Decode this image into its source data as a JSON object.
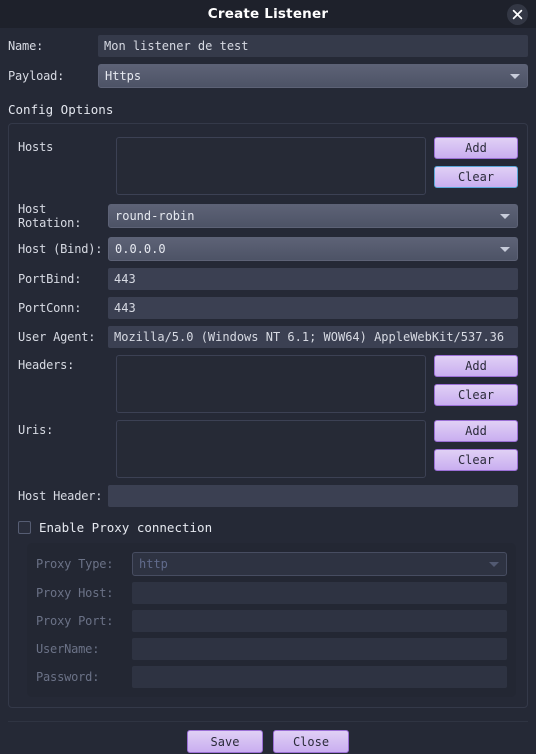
{
  "window": {
    "title": "Create Listener",
    "close_icon": "close-icon"
  },
  "form": {
    "name": {
      "label": "Name:",
      "value": "Mon listener de test"
    },
    "payload": {
      "label": "Payload:",
      "value": "Https"
    }
  },
  "config": {
    "group_title": "Config Options",
    "hosts": {
      "label": "Hosts",
      "items": [],
      "add_label": "Add",
      "clear_label": "Clear"
    },
    "host_rotation": {
      "label": "Host Rotation:",
      "value": "round-robin"
    },
    "host_bind": {
      "label": "Host (Bind):",
      "value": "0.0.0.0"
    },
    "port_bind": {
      "label": "PortBind:",
      "value": "443"
    },
    "port_conn": {
      "label": "PortConn:",
      "value": "443"
    },
    "user_agent": {
      "label": "User Agent:",
      "value": "Mozilla/5.0 (Windows NT 6.1; WOW64) AppleWebKit/537.36"
    },
    "headers": {
      "label": "Headers:",
      "items": [],
      "add_label": "Add",
      "clear_label": "Clear"
    },
    "uris": {
      "label": "Uris:",
      "items": [],
      "add_label": "Add",
      "clear_label": "Clear"
    },
    "host_header": {
      "label": "Host Header:",
      "value": ""
    }
  },
  "proxy": {
    "enable_label": "Enable Proxy connection",
    "enabled": false,
    "type": {
      "label": "Proxy Type:",
      "value": "http"
    },
    "host": {
      "label": "Proxy Host:",
      "value": ""
    },
    "port": {
      "label": "Proxy Port:",
      "value": ""
    },
    "username": {
      "label": "UserName:",
      "value": ""
    },
    "password": {
      "label": "Password:",
      "value": ""
    }
  },
  "footer": {
    "save_label": "Save",
    "close_label": "Close"
  },
  "colors": {
    "window_bg": "#252936",
    "titlebar_bg": "#1e212b",
    "accent_purple": "#c9aef0",
    "accent_border": "#9b6fd6",
    "focus_blue": "#5aa7d8",
    "text": "#d7dae3",
    "disabled_text": "#6b7287"
  }
}
